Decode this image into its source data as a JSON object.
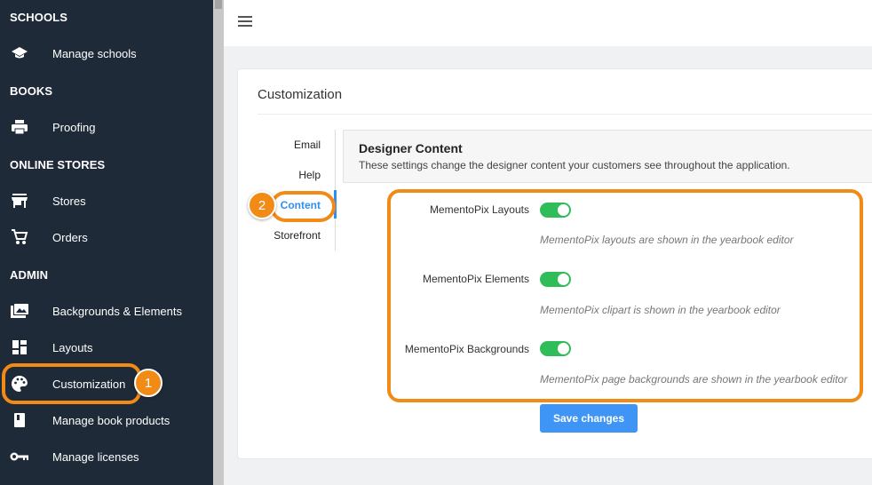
{
  "sidebar": {
    "sections": [
      {
        "title": "SCHOOLS",
        "items": [
          {
            "label": "Manage schools",
            "icon": "graduation-cap-icon"
          }
        ]
      },
      {
        "title": "BOOKS",
        "items": [
          {
            "label": "Proofing",
            "icon": "printer-icon"
          }
        ]
      },
      {
        "title": "ONLINE STORES",
        "items": [
          {
            "label": "Stores",
            "icon": "storefront-icon"
          },
          {
            "label": "Orders",
            "icon": "cart-icon"
          }
        ]
      },
      {
        "title": "ADMIN",
        "items": [
          {
            "label": "Backgrounds & Elements",
            "icon": "images-icon"
          },
          {
            "label": "Layouts",
            "icon": "dashboard-icon"
          },
          {
            "label": "Customization",
            "icon": "palette-icon"
          },
          {
            "label": "Manage book products",
            "icon": "book-icon"
          },
          {
            "label": "Manage licenses",
            "icon": "key-icon"
          }
        ]
      }
    ]
  },
  "card": {
    "title": "Customization",
    "tabs": [
      "Email",
      "Help",
      "Content",
      "Storefront"
    ],
    "active_tab": "Content"
  },
  "section": {
    "heading": "Designer Content",
    "description": "These settings change the designer content your customers see throughout the application."
  },
  "settings": [
    {
      "label": "MementoPix Layouts",
      "enabled": true,
      "description": "MementoPix layouts are shown in the yearbook editor"
    },
    {
      "label": "MementoPix Elements",
      "enabled": true,
      "description": "MementoPix clipart is shown in the yearbook editor"
    },
    {
      "label": "MementoPix Backgrounds",
      "enabled": true,
      "description": "MementoPix page backgrounds are shown in the yearbook editor"
    }
  ],
  "save_label": "Save changes",
  "callouts": [
    "1",
    "2"
  ],
  "colors": {
    "sidebar": "#1f2a38",
    "accent": "#2e8ff0",
    "toggle_on": "#2ebd59",
    "highlight": "#f28a16",
    "button": "#3f95f5"
  }
}
